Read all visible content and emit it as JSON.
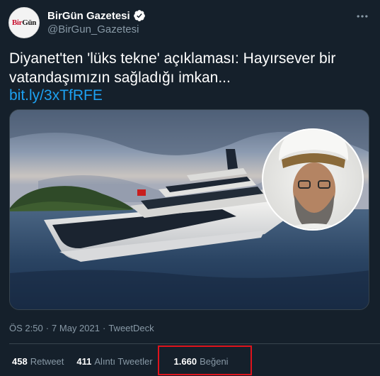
{
  "account": {
    "display_name": "BirGün Gazetesi",
    "handle": "@BirGun_Gazetesi",
    "avatar_logo_part1": "Bir",
    "avatar_logo_part2": "Gün"
  },
  "tweet": {
    "text": "Diyanet'ten 'lüks tekne' açıklaması: Hayırsever bir vatandaşımızın sağladığı imkan...",
    "link": "bit.ly/3xTfRFE"
  },
  "meta": {
    "time": "ÖS 2:50",
    "separator1": "·",
    "date": "7 May 2021",
    "separator2": "·",
    "source": "TweetDeck"
  },
  "stats": {
    "retweets": {
      "count": "458",
      "label": "Retweet"
    },
    "quotes": {
      "count": "411",
      "label": "Alıntı Tweetler"
    },
    "likes": {
      "count": "1.660",
      "label": "Beğeni"
    }
  },
  "colors": {
    "background": "#15202b",
    "secondary_text": "#8899a6",
    "link": "#1da1f2",
    "verified": "#ffffff",
    "highlight": "#e0131c"
  },
  "icons": {
    "verified": "verified-badge-icon",
    "more": "more-horizontal-icon"
  }
}
